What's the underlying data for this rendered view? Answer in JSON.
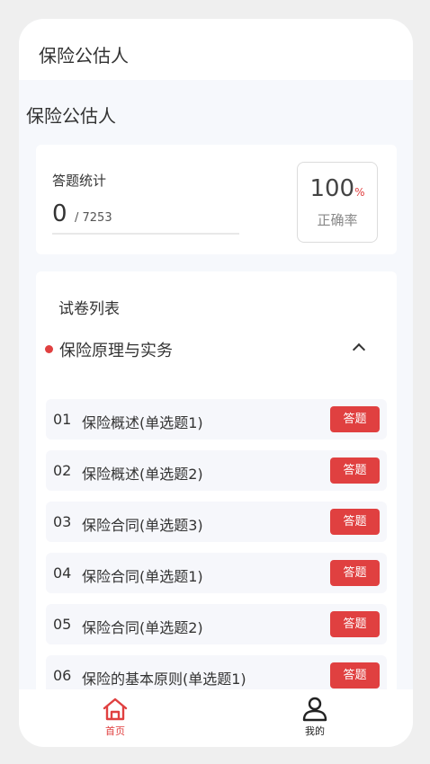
{
  "header": {
    "title": "保险公估人"
  },
  "page": {
    "title": "保险公估人"
  },
  "stats": {
    "label": "答题统计",
    "answered": "0",
    "total": "/ 7253",
    "rate_value": "100",
    "rate_unit": "%",
    "rate_label": "正确率"
  },
  "papers": {
    "title": "试卷列表",
    "section": {
      "title": "保险原理与实务",
      "expanded": true
    },
    "items": [
      {
        "num": "01",
        "name": "保险概述(单选题1)",
        "action": "答题"
      },
      {
        "num": "02",
        "name": "保险概述(单选题2)",
        "action": "答题"
      },
      {
        "num": "03",
        "name": "保险合同(单选题3)",
        "action": "答题"
      },
      {
        "num": "04",
        "name": "保险合同(单选题1)",
        "action": "答题"
      },
      {
        "num": "05",
        "name": "保险合同(单选题2)",
        "action": "答题"
      },
      {
        "num": "06",
        "name": "保险的基本原则(单选题1)",
        "action": "答题"
      }
    ]
  },
  "tabbar": {
    "home": {
      "label": "首页",
      "icon": "home-icon",
      "active": true
    },
    "me": {
      "label": "我的",
      "icon": "user-icon",
      "active": false
    }
  },
  "colors": {
    "accent": "#e04040",
    "background": "#f6f8fc"
  }
}
